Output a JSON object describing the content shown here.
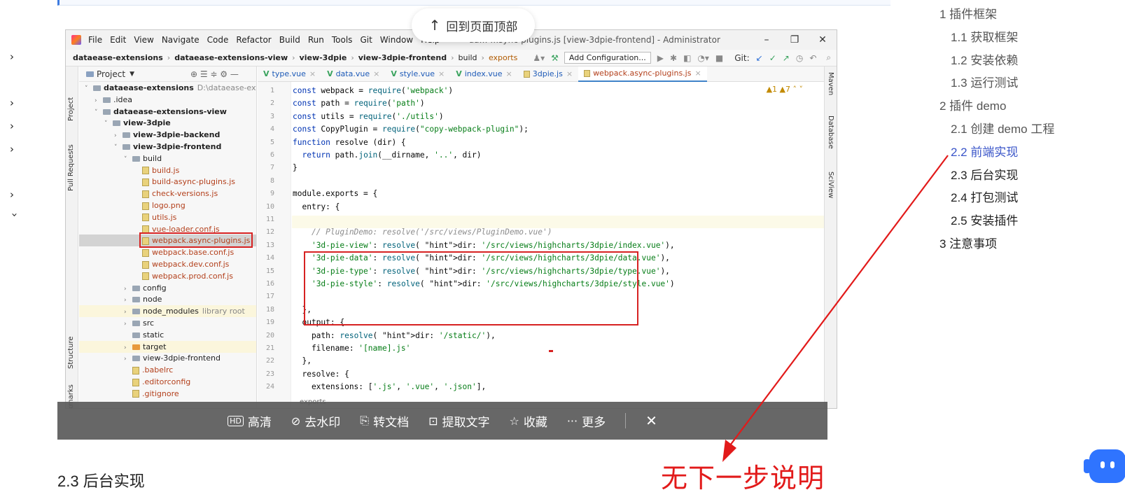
{
  "back_to_top": {
    "label": "回到页面顶部"
  },
  "ide": {
    "menu": [
      "File",
      "Edit",
      "View",
      "Navigate",
      "Code",
      "Refactor",
      "Build",
      "Run",
      "Tools",
      "Git",
      "Window",
      "Help"
    ],
    "title": "da…  …sync-plugins.js [view-3dpie-frontend] - Administrator",
    "breadcrumbs": [
      "dataease-extensions",
      "dataease-extensions-view",
      "view-3dpie",
      "view-3dpie-frontend",
      "build"
    ],
    "breadcrumb_current": "exports",
    "add_config": "Add Configuration...",
    "git_label": "Git:",
    "left_tabs": [
      "Project",
      "Pull Requests",
      "Structure",
      "Bookmarks"
    ],
    "right_tabs": [
      "Maven",
      "Database",
      "SciView"
    ],
    "project_header": "Project",
    "tree": [
      {
        "label": "dataease-extensions",
        "suffix": "D:\\dataease-extensions",
        "depth": 0,
        "kind": "folder",
        "open": true,
        "bold": true
      },
      {
        "label": ".idea",
        "depth": 1,
        "kind": "folder",
        "open": false
      },
      {
        "label": "dataease-extensions-view",
        "depth": 1,
        "kind": "folder",
        "open": true,
        "bold": true
      },
      {
        "label": "view-3dpie",
        "depth": 2,
        "kind": "folder",
        "open": true,
        "bold": true
      },
      {
        "label": "view-3dpie-backend",
        "depth": 3,
        "kind": "folder",
        "open": false,
        "bold": true
      },
      {
        "label": "view-3dpie-frontend",
        "depth": 3,
        "kind": "folder",
        "open": true,
        "bold": true
      },
      {
        "label": "build",
        "depth": 4,
        "kind": "folder",
        "open": true
      },
      {
        "label": "build.js",
        "depth": 5,
        "kind": "file",
        "red": true
      },
      {
        "label": "build-async-plugins.js",
        "depth": 5,
        "kind": "file",
        "red": true
      },
      {
        "label": "check-versions.js",
        "depth": 5,
        "kind": "file",
        "red": true
      },
      {
        "label": "logo.png",
        "depth": 5,
        "kind": "file",
        "red": true
      },
      {
        "label": "utils.js",
        "depth": 5,
        "kind": "file",
        "red": true
      },
      {
        "label": "vue-loader.conf.js",
        "depth": 5,
        "kind": "file",
        "red": true
      },
      {
        "label": "webpack.async-plugins.js",
        "depth": 5,
        "kind": "file",
        "red": true,
        "selected": true
      },
      {
        "label": "webpack.base.conf.js",
        "depth": 5,
        "kind": "file",
        "red": true
      },
      {
        "label": "webpack.dev.conf.js",
        "depth": 5,
        "kind": "file",
        "red": true
      },
      {
        "label": "webpack.prod.conf.js",
        "depth": 5,
        "kind": "file",
        "red": true
      },
      {
        "label": "config",
        "depth": 4,
        "kind": "folder",
        "open": false
      },
      {
        "label": "node",
        "depth": 4,
        "kind": "folder",
        "open": false
      },
      {
        "label": "node_modules",
        "suffix": "library root",
        "depth": 4,
        "kind": "folder",
        "open": false,
        "highlight": true
      },
      {
        "label": "src",
        "depth": 4,
        "kind": "folder",
        "open": false
      },
      {
        "label": "static",
        "depth": 4,
        "kind": "folder",
        "leaf": true
      },
      {
        "label": "target",
        "depth": 4,
        "kind": "folder",
        "open": false,
        "orange": true,
        "highlight": true
      },
      {
        "label": "view-3dpie-frontend",
        "depth": 4,
        "kind": "folder",
        "open": false
      },
      {
        "label": ".babelrc",
        "depth": 4,
        "kind": "file",
        "red": true
      },
      {
        "label": ".editorconfig",
        "depth": 4,
        "kind": "file",
        "red": true
      },
      {
        "label": ".gitignore",
        "depth": 4,
        "kind": "file",
        "red": true
      }
    ],
    "tabs": [
      {
        "label": "type.vue",
        "kind": "vue"
      },
      {
        "label": "data.vue",
        "kind": "vue"
      },
      {
        "label": "style.vue",
        "kind": "vue"
      },
      {
        "label": "index.vue",
        "kind": "vue"
      },
      {
        "label": "3dpie.js",
        "kind": "js"
      },
      {
        "label": "webpack.async-plugins.js",
        "kind": "js",
        "active": true
      }
    ],
    "warnings": "▲1 ▲7 ˄ ˅",
    "code_lines": [
      "const webpack = require('webpack')",
      "const path = require('path')",
      "const utils = require('./utils')",
      "const CopyPlugin = require(\"copy-webpack-plugin\");",
      "function resolve (dir) {",
      "  return path.join(__dirname, '..', dir)",
      "}",
      "",
      "module.exports = {",
      "  entry: {",
      "",
      "    // PluginDemo: resolve('/src/views/PluginDemo.vue')",
      "    '3d-pie-view': resolve( dir: '/src/views/highcharts/3dpie/index.vue'),",
      "    '3d-pie-data': resolve( dir: '/src/views/highcharts/3dpie/data.vue'),",
      "    '3d-pie-type': resolve( dir: '/src/views/highcharts/3dpie/type.vue'),",
      "    '3d-pie-style': resolve( dir: '/src/views/highcharts/3dpie/style.vue')",
      "",
      "  },",
      "  output: {",
      "    path: resolve( dir: '/static/'),",
      "    filename: '[name].js'",
      "  },",
      "  resolve: {",
      "    extensions: ['.js', '.vue', '.json'],"
    ],
    "status_crumb": "exports"
  },
  "viewer_toolbar": {
    "items": [
      {
        "icon": "HD",
        "label": "高清"
      },
      {
        "icon": "⊘",
        "label": "去水印"
      },
      {
        "icon": "⎘",
        "label": "转文档"
      },
      {
        "icon": "⊡",
        "label": "提取文字"
      },
      {
        "icon": "☆",
        "label": "收藏"
      },
      {
        "icon": "···",
        "label": "更多"
      }
    ],
    "close": "✕"
  },
  "section_heading": "2.3 后台实现",
  "annotation": {
    "text": "无下一步说明",
    "color": "#e21a1a"
  },
  "toc": [
    {
      "label": "1 插件框架",
      "level": 1
    },
    {
      "label": "1.1 获取框架",
      "level": 2
    },
    {
      "label": "1.2 安装依赖",
      "level": 2
    },
    {
      "label": "1.3 运行测试",
      "level": 2
    },
    {
      "label": "2 插件 demo",
      "level": 1
    },
    {
      "label": "2.1 创建 demo 工程",
      "level": 2
    },
    {
      "label": "2.2 前端实现",
      "level": 2,
      "active": true
    },
    {
      "label": "2.3 后台实现",
      "level": 2,
      "dark": true
    },
    {
      "label": "2.4 打包测试",
      "level": 2,
      "dark": true
    },
    {
      "label": "2.5 安装插件",
      "level": 2,
      "dark": true
    },
    {
      "label": "3 注意事项",
      "level": 1,
      "dark": true
    }
  ],
  "colors": {
    "accent": "#3a55c9",
    "annotation_red": "#e21a1a",
    "chat_blue": "#2f74ff"
  }
}
